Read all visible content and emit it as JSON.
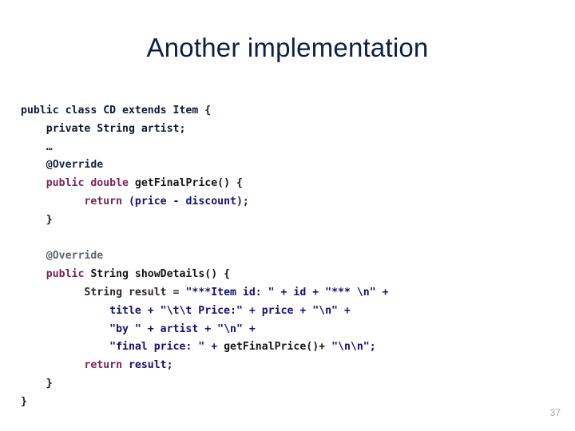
{
  "slide": {
    "title": "Another implementation",
    "page_number": "37",
    "title_color": "#0d2048",
    "page_number_color": "#a6a6a6",
    "background_color": "#ffffff"
  },
  "code": {
    "language": "java",
    "colors": {
      "keyword": "#7b2357",
      "identifier": "#151515",
      "string_and_expression": "#12126e",
      "annotation": "#152540",
      "annotation_secondary": "#5d6675"
    },
    "lines": [
      {
        "id": "line-class-decl",
        "indent": 0,
        "tokens": [
          {
            "text": "public class CD extends Item {",
            "style": "tok-dark"
          }
        ]
      },
      {
        "id": "line-field-artist",
        "indent": 4,
        "tokens": [
          {
            "text": "private String artist;",
            "style": "tok-dark"
          }
        ]
      },
      {
        "id": "line-ellipsis",
        "indent": 4,
        "tokens": [
          {
            "text": "…",
            "style": "tok-dots"
          }
        ]
      },
      {
        "id": "line-override-1",
        "indent": 4,
        "tokens": [
          {
            "text": "@Override",
            "style": "tok-ann"
          }
        ]
      },
      {
        "id": "line-getfinalprice-sig",
        "indent": 4,
        "tokens": [
          {
            "text": "public double ",
            "style": "tok-kw"
          },
          {
            "text": "getFinalPrice() {",
            "style": "tok-plain"
          }
        ]
      },
      {
        "id": "line-return-price",
        "indent": 10,
        "tokens": [
          {
            "text": "return ",
            "style": "tok-kw"
          },
          {
            "text": "(price - discount);",
            "style": "tok-navy"
          }
        ]
      },
      {
        "id": "line-close-getfinalprice",
        "indent": 4,
        "tokens": [
          {
            "text": "}",
            "style": "tok-plain"
          }
        ]
      },
      {
        "id": "line-blank-1",
        "indent": 0,
        "tokens": [
          {
            "text": " ",
            "style": "tok-plain"
          }
        ]
      },
      {
        "id": "line-override-2",
        "indent": 4,
        "tokens": [
          {
            "text": "@Override",
            "style": "tok-ann-sub"
          }
        ]
      },
      {
        "id": "line-showdetails-sig",
        "indent": 4,
        "tokens": [
          {
            "text": "public ",
            "style": "tok-kw"
          },
          {
            "text": "String showDetails() {",
            "style": "tok-plain"
          }
        ]
      },
      {
        "id": "line-result-init",
        "indent": 10,
        "tokens": [
          {
            "text": "String result = ",
            "style": "tok-ident"
          },
          {
            "text": "\"***Item id: \" + id + \"*** \\n\" +",
            "style": "tok-navy"
          }
        ]
      },
      {
        "id": "line-title-price",
        "indent": 14,
        "tokens": [
          {
            "text": "title + \"\\t\\t Price:\" + price + \"\\n\" +",
            "style": "tok-navy"
          }
        ]
      },
      {
        "id": "line-by-artist",
        "indent": 14,
        "tokens": [
          {
            "text": "\"by \" + artist + \"\\n\" +",
            "style": "tok-navy"
          }
        ]
      },
      {
        "id": "line-final-price",
        "indent": 14,
        "tokens": [
          {
            "text": "\"final price: \" + ",
            "style": "tok-navy"
          },
          {
            "text": "getFinalPrice()+ ",
            "style": "tok-plain"
          },
          {
            "text": "\"\\n\\n\";",
            "style": "tok-navy"
          }
        ]
      },
      {
        "id": "line-return-result",
        "indent": 10,
        "tokens": [
          {
            "text": "return ",
            "style": "tok-kw"
          },
          {
            "text": "result;",
            "style": "tok-navy"
          }
        ]
      },
      {
        "id": "line-close-showdetails",
        "indent": 4,
        "tokens": [
          {
            "text": "}",
            "style": "tok-plain"
          }
        ]
      },
      {
        "id": "line-close-class",
        "indent": 0,
        "tokens": [
          {
            "text": "}",
            "style": "tok-dark"
          }
        ]
      }
    ]
  }
}
